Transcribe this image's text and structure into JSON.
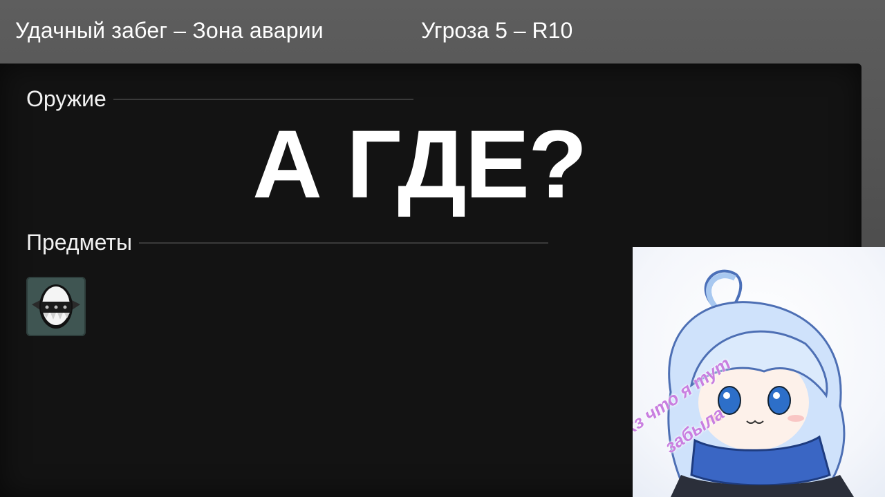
{
  "header": {
    "run_title": "Удачный забег – Зона аварии",
    "threat": "Угроза 5 – R10"
  },
  "panel": {
    "weapons_label": "Оружие",
    "items_label": "Предметы",
    "overlay_text": "А ГДЕ?",
    "items": [
      {
        "icon": "spiked-egg-icon"
      }
    ]
  },
  "avatar": {
    "icon": "chibi-girl-avatar",
    "caption_line1": "Я хз что я тут",
    "caption_line2": "забыла"
  },
  "colors": {
    "panel_bg": "#131313",
    "item_slot_bg": "#3f5552",
    "caption": "#c97fe0"
  }
}
